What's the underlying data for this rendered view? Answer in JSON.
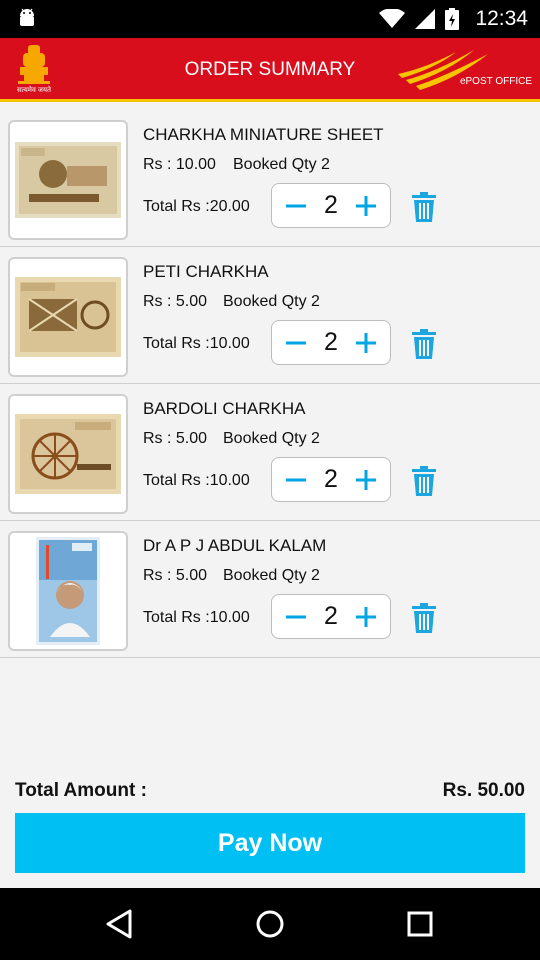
{
  "status_bar": {
    "time": "12:34"
  },
  "app_bar": {
    "title": "ORDER SUMMARY",
    "emblem_text": "सत्यमेव जयते",
    "brand_text": "ePOST OFFICE",
    "brand_color": "#d80e1c",
    "accent_color": "#f6c400"
  },
  "items": [
    {
      "name": "CHARKHA MINIATURE SHEET",
      "price": "Rs : 10.00",
      "booked": "Booked Qty 2",
      "total": "Total Rs :20.00",
      "qty": "2",
      "stamp": "charkha-miniature-sheet"
    },
    {
      "name": "PETI CHARKHA",
      "price": "Rs : 5.00",
      "booked": "Booked Qty 2",
      "total": "Total Rs :10.00",
      "qty": "2",
      "stamp": "peti-charkha"
    },
    {
      "name": "BARDOLI CHARKHA",
      "price": "Rs : 5.00",
      "booked": "Booked Qty 2",
      "total": "Total Rs :10.00",
      "qty": "2",
      "stamp": "bardoli-charkha"
    },
    {
      "name": "Dr A P J ABDUL KALAM",
      "price": "Rs : 5.00",
      "booked": "Booked Qty 2",
      "total": "Total Rs :10.00",
      "qty": "2",
      "stamp": "abdul-kalam"
    }
  ],
  "footer": {
    "total_label": "Total Amount :",
    "total_value": "Rs. 50.00",
    "pay_button": "Pay Now",
    "pay_color": "#00bff3"
  },
  "stepper": {
    "icon_color": "#00a6e4"
  },
  "icons": {
    "minus": "minus-icon",
    "plus": "plus-icon",
    "delete": "trash-icon",
    "nav_back": "back-triangle-icon",
    "nav_home": "home-circle-icon",
    "nav_recents": "recents-square-icon"
  }
}
